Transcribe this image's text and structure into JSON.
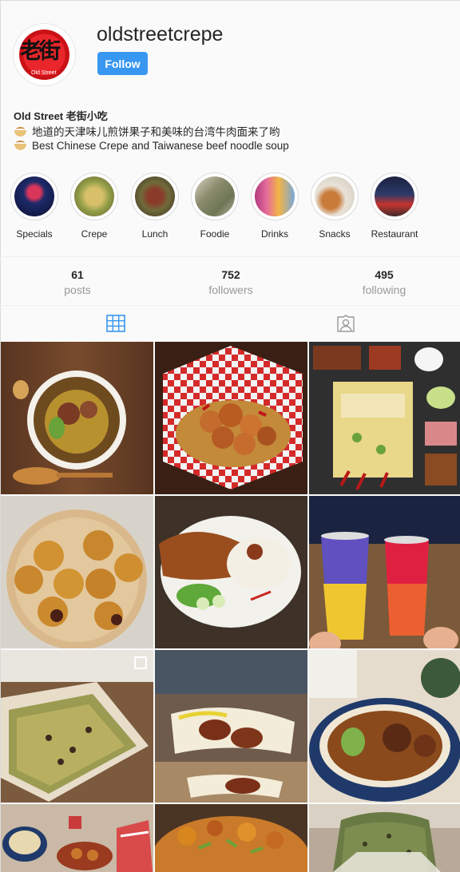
{
  "profile": {
    "username": "oldstreetcrepe",
    "follow_label": "Follow",
    "display_name": "Old Street 老街小吃",
    "bio_lines": [
      "地道的天津味儿煎饼果子和美味的台湾牛肉面来了哟",
      "Best Chinese Crepe and Taiwanese beef noodle soup"
    ],
    "avatar_icon": "restaurant-logo-icon",
    "avatar_logo_text": "老街",
    "avatar_logo_small": "Old Street"
  },
  "highlights": [
    {
      "label": "Specials"
    },
    {
      "label": "Crepe"
    },
    {
      "label": "Lunch"
    },
    {
      "label": "Foodie"
    },
    {
      "label": "Drinks"
    },
    {
      "label": "Snacks"
    },
    {
      "label": "Restaurant"
    }
  ],
  "stats": [
    {
      "value": "61",
      "label": "posts"
    },
    {
      "value": "752",
      "label": "followers"
    },
    {
      "value": "495",
      "label": "following"
    }
  ],
  "tabs": [
    {
      "icon": "grid-icon",
      "active": true
    },
    {
      "icon": "tagged-icon",
      "active": false
    }
  ],
  "colors": {
    "accent": "#3897f0",
    "text": "#262626",
    "muted": "#999999",
    "background": "#fafafa"
  }
}
